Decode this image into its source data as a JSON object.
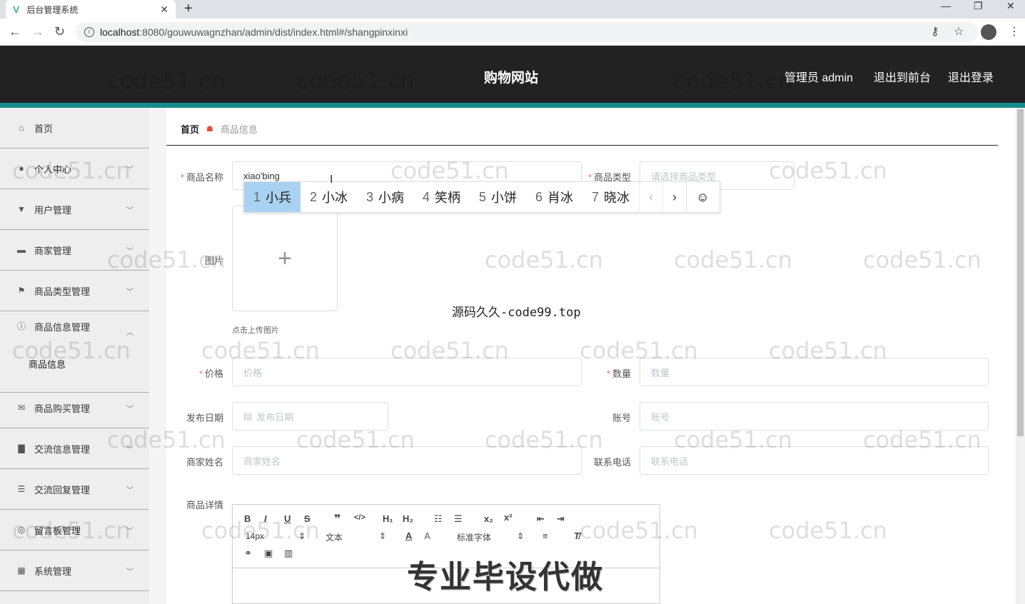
{
  "browser": {
    "tab_title": "后台管理系统",
    "url_host": "localhost",
    "url_path": ":8080/gouwuwagnzhan/admin/dist/index.html#/shangpinxinxi"
  },
  "header": {
    "site_title": "购物网站",
    "admin_label": "管理员 admin",
    "to_front": "退出到前台",
    "logout": "退出登录"
  },
  "sidebar": {
    "items": [
      {
        "label": "首页",
        "icon": "home-icon"
      },
      {
        "label": "个人中心",
        "icon": "person-icon"
      },
      {
        "label": "用户管理",
        "icon": "user-manage-icon"
      },
      {
        "label": "商家管理",
        "icon": "shop-icon"
      },
      {
        "label": "商品类型管理",
        "icon": "flag-icon"
      },
      {
        "label": "商品信息管理",
        "icon": "info-icon"
      },
      {
        "label": "商品购买管理",
        "icon": "mail-icon"
      },
      {
        "label": "交流信息管理",
        "icon": "chat-icon"
      },
      {
        "label": "交流回复管理",
        "icon": "sliders-icon"
      },
      {
        "label": "留言板管理",
        "icon": "message-board-icon"
      },
      {
        "label": "系统管理",
        "icon": "grid-icon"
      }
    ],
    "sub_item": "商品信息"
  },
  "breadcrumb": {
    "home": "首页",
    "current": "商品信息"
  },
  "form": {
    "name_label": "商品名称",
    "name_value": "xiao'bing",
    "type_label": "商品类型",
    "type_placeholder": "请选择商品类型",
    "image_label": "图片",
    "upload_tip": "点击上传图片",
    "price_label": "价格",
    "price_placeholder": "价格",
    "qty_label": "数量",
    "qty_placeholder": "数量",
    "date_label": "发布日期",
    "date_placeholder": "发布日期",
    "account_label": "账号",
    "account_placeholder": "账号",
    "merchant_label": "商家姓名",
    "merchant_placeholder": "商家姓名",
    "phone_label": "联系电话",
    "phone_placeholder": "联系电话",
    "detail_label": "商品详情"
  },
  "ime": {
    "candidates": [
      {
        "num": "1",
        "word": "小兵"
      },
      {
        "num": "2",
        "word": "小冰"
      },
      {
        "num": "3",
        "word": "小病"
      },
      {
        "num": "4",
        "word": "笑柄"
      },
      {
        "num": "5",
        "word": "小饼"
      },
      {
        "num": "6",
        "word": "肖冰"
      },
      {
        "num": "7",
        "word": "晓冰"
      }
    ]
  },
  "editor": {
    "size": "14px",
    "block": "文本",
    "font": "标准字体"
  },
  "overlay": {
    "watermark": "code51.cn",
    "center_note": "源码久久-code99.top",
    "big_note": "专业毕设代做"
  }
}
